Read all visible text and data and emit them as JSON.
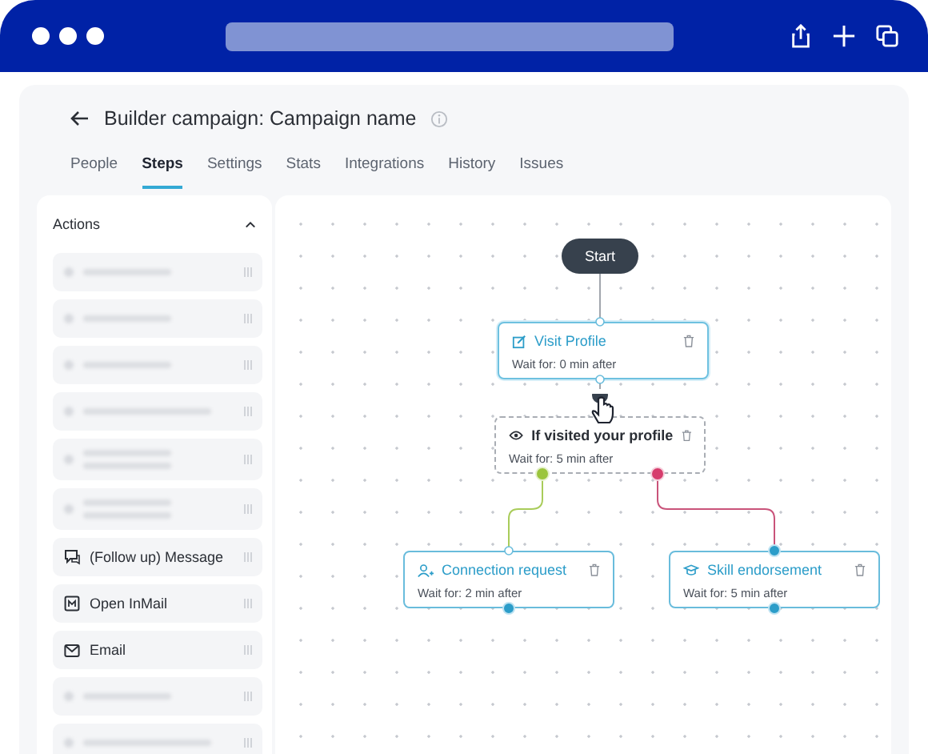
{
  "header": {
    "title": "Builder campaign: Campaign name"
  },
  "tabs": [
    {
      "label": "People",
      "selected": false
    },
    {
      "label": "Steps",
      "selected": true
    },
    {
      "label": "Settings",
      "selected": false
    },
    {
      "label": "Stats",
      "selected": false
    },
    {
      "label": "Integrations",
      "selected": false
    },
    {
      "label": "History",
      "selected": false
    },
    {
      "label": "Issues",
      "selected": false
    }
  ],
  "sidebar": {
    "title": "Actions",
    "expanded": true,
    "items": [
      {
        "kind": "skeleton"
      },
      {
        "kind": "skeleton"
      },
      {
        "kind": "skeleton"
      },
      {
        "kind": "skeletonlong"
      },
      {
        "kind": "skeletontwoline"
      },
      {
        "kind": "skeletontwoline"
      },
      {
        "kind": "message",
        "label": "(Follow up) Message"
      },
      {
        "kind": "inmail",
        "label": "Open InMail"
      },
      {
        "kind": "email",
        "label": "Email"
      },
      {
        "kind": "skeleton"
      },
      {
        "kind": "skeletonlong"
      }
    ]
  },
  "canvas": {
    "start": {
      "label": "Start"
    },
    "nodes": [
      {
        "kind": "visit",
        "title": "Visit Profile",
        "wait": "Wait for: 0 min after",
        "selected": true
      },
      {
        "kind": "condition",
        "title": "If visited your profile",
        "wait": "Wait for: 5 min after",
        "selected": false
      },
      {
        "kind": "connect",
        "title": "Connection request",
        "wait": "Wait for: 2 min after",
        "selected": false
      },
      {
        "kind": "endorse",
        "title": "Skill endorsement",
        "wait": "Wait for: 5 min after",
        "selected": false
      }
    ]
  }
}
